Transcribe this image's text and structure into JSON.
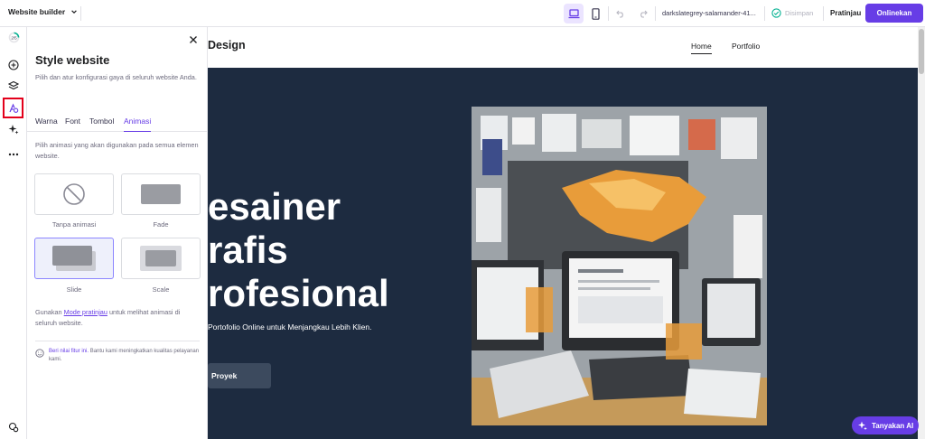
{
  "topbar": {
    "app_title": "Website builder",
    "domain": "darkslategrey-salamander-41...",
    "saved_label": "Disimpan",
    "preview_label": "Pratinjau",
    "publish_label": "Onlinekan"
  },
  "panel": {
    "title": "Style website",
    "description": "Pilih dan atur konfigurasi gaya di seluruh website Anda.",
    "tabs": [
      {
        "label": "Warna"
      },
      {
        "label": "Font"
      },
      {
        "label": "Tombol"
      },
      {
        "label": "Animasi"
      }
    ],
    "active_tab": "Animasi",
    "animation_description": "Pilih animasi yang akan digunakan pada semua elemen website.",
    "options": [
      {
        "label": "Tanpa animasi"
      },
      {
        "label": "Fade"
      },
      {
        "label": "Slide"
      },
      {
        "label": "Scale"
      }
    ],
    "selected_option": "Slide",
    "hint_prefix": "Gunakan",
    "hint_link": "Mode pratinjau",
    "hint_suffix": "untuk melihat animasi di seluruh website.",
    "feedback_link": "Beri nilai fitur ini.",
    "feedback_text": "Bantu kami meningkatkan kualitas pelayanan kami."
  },
  "site": {
    "logo": "Design",
    "nav": {
      "home": "Home",
      "portfolio": "Portfolio"
    },
    "hero": {
      "title_line1": "esainer",
      "title_line2": "rafis",
      "title_line3": "rofesional",
      "subtitle": "Portofolio Online untuk Menjangkau Lebih Klien.",
      "button": "Proyek"
    }
  },
  "assistant": {
    "label": "Tanyakan AI"
  },
  "colors": {
    "accent": "#673de6",
    "hero_bg": "#1d2b40",
    "highlight": "#e3001b"
  }
}
